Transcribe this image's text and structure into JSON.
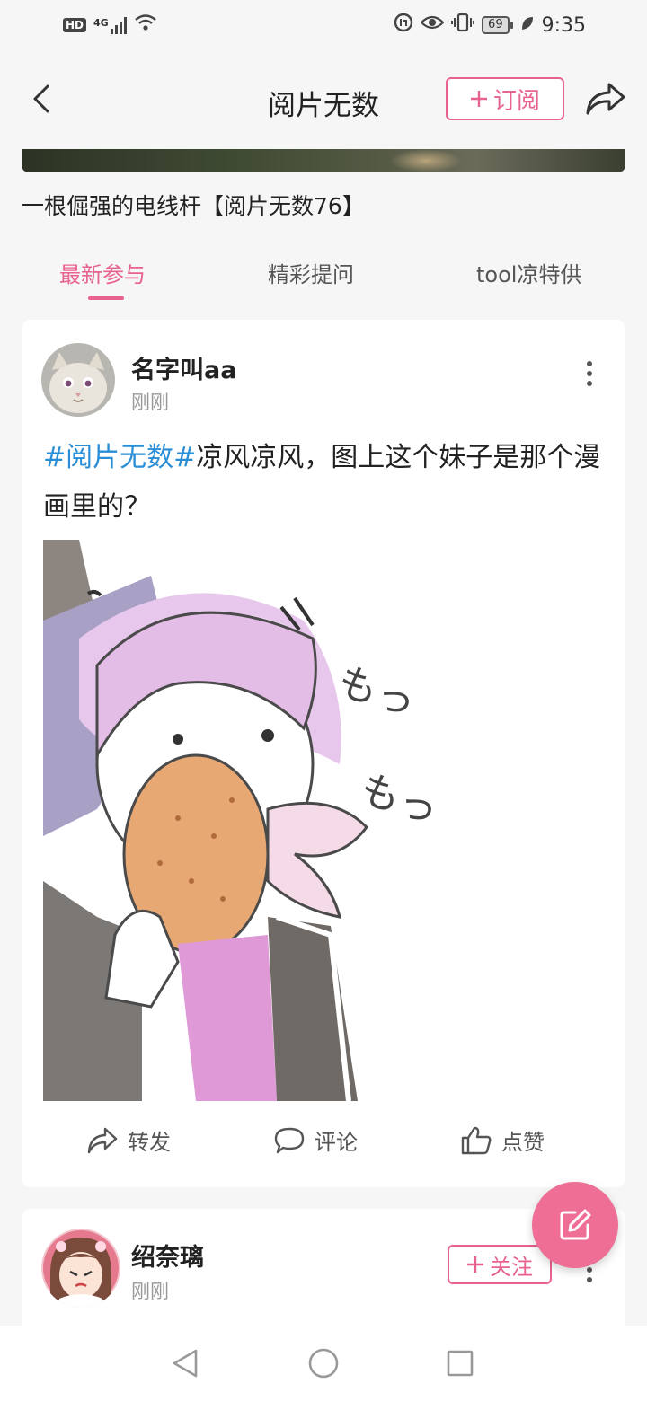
{
  "status_bar": {
    "hd_label": "HD",
    "network_label": "4G",
    "battery_level": "69",
    "time": "9:35"
  },
  "header": {
    "title": "阅片无数",
    "subscribe_label": "订阅"
  },
  "banner": {
    "caption": "一根倔强的电线杆【阅片无数76】"
  },
  "tabs": [
    {
      "label": "最新参与",
      "active": true
    },
    {
      "label": "精彩提问",
      "active": false
    },
    {
      "label": "tool凉特供",
      "active": false
    }
  ],
  "posts": [
    {
      "username": "名字叫aa",
      "time": "刚刚",
      "hashtag": "#阅片无数#",
      "text": "凉风凉风，图上这个妹子是那个漫画里的？",
      "image_text": "もっもっ",
      "actions": {
        "repost_label": "转发",
        "comment_label": "评论",
        "like_label": "点赞"
      }
    },
    {
      "username": "绍奈璃",
      "time": "刚刚",
      "follow_label": "关注"
    }
  ],
  "colors": {
    "accent": "#e8628e",
    "hashtag": "#2a8ed6",
    "fab": "#ee6e95"
  }
}
